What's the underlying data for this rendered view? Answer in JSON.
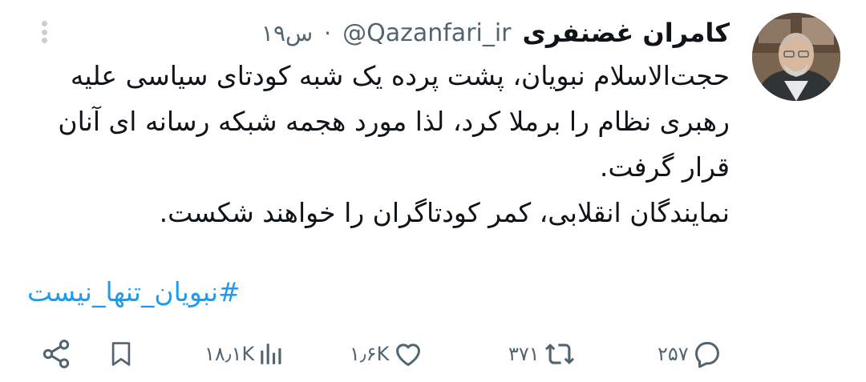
{
  "author": {
    "display_name": "کامران غضنفری",
    "handle": "@Qazanfari_ir",
    "time": "۱۹س",
    "separator": "·"
  },
  "tweet": {
    "paragraph1": "حجت‌الاسلام نبویان، پشت پرده یک شبه کودتای سیاسی علیه رهبری نظام را برملا کرد، لذا مورد هجمه شبکه رسانه ای آنان قرار گرفت.",
    "paragraph2": "نمایندگان انقلابی، کمر کودتاگران را خواهند شکست.",
    "hashtag": "#نبویان_تنها_نیست"
  },
  "actions": {
    "replies": "۲۵۷",
    "retweets": "۳۷۱",
    "likes": "۱٫۶K",
    "views": "۱۸٫۱K"
  },
  "icons": {
    "more": "more-vertical-icon",
    "reply": "reply-icon",
    "retweet": "retweet-icon",
    "like": "heart-icon",
    "views": "views-chart-icon",
    "bookmark": "bookmark-icon",
    "share": "share-icon"
  },
  "colors": {
    "text": "#0f1419",
    "secondary": "#536471",
    "link": "#1d9bf0"
  }
}
